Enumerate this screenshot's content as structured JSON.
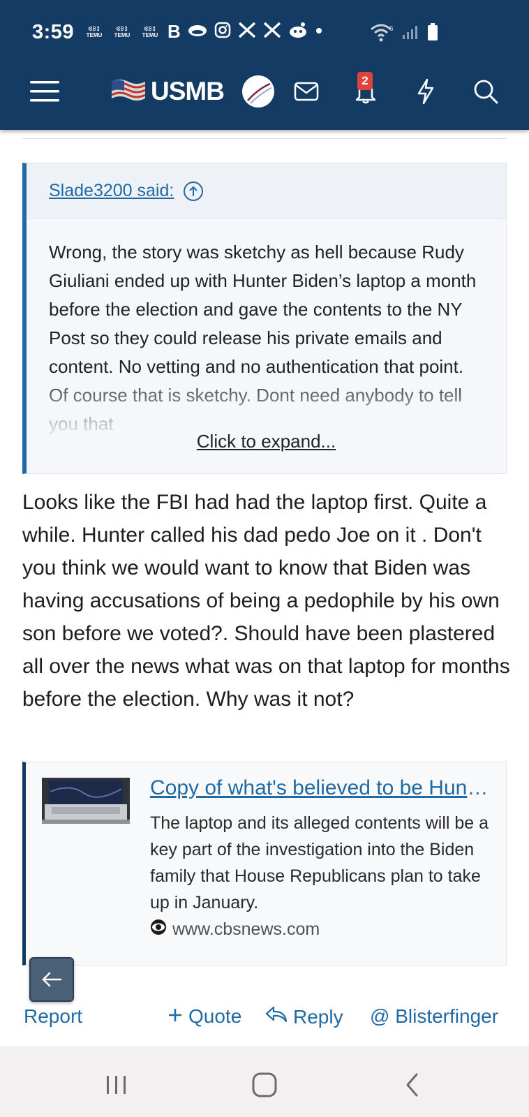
{
  "status_bar": {
    "time": "3:59",
    "notification_icons": [
      "temu-icon",
      "temu-icon",
      "temu-icon",
      "b-icon",
      "cloud-icon",
      "instagram-icon",
      "x-icon",
      "x-icon",
      "reddit-icon",
      "dot-icon"
    ],
    "temu_label": "TEMU",
    "b_label": "B",
    "wifi_label": "6"
  },
  "header": {
    "logo_text": "USMB",
    "notification_count": "2",
    "icons": [
      "menu-icon",
      "mail-icon",
      "bell-icon",
      "lightning-icon",
      "search-icon"
    ],
    "background_color": "#133b63"
  },
  "quote": {
    "author": "Slade3200 said:",
    "text": "Wrong, the story was sketchy as hell because Rudy Giuliani ended up with Hunter Biden’s laptop a month before the election and gave the contents to the NY Post so they could release his private emails and content. No vetting and no authentication that point. Of course that is sketchy. Dont need anybody to tell you that",
    "expand_label": "Click to expand..."
  },
  "post": {
    "text": "Looks like the FBI had had the laptop first. Quite a while. Hunter called his dad pedo Joe on it . Don't you think we would want to know that Biden was having accusations of being a pedophile by his own son before we voted?. Should have been plastered all over the news what was on that laptop for months before the election. Why was it not?"
  },
  "link_preview": {
    "title": "Copy of what's believed to be Hunter Biden's laptop data...",
    "description": "The laptop and its alleged contents will be a key part of the investigation into the Biden family that House Republicans plan to take up in January.",
    "site": "www.cbsnews.com"
  },
  "actions": {
    "report": "Report",
    "quote": "Quote",
    "reply": "Reply",
    "mention": "@ Blisterfinger"
  },
  "accent_color": "#1f6aa5"
}
